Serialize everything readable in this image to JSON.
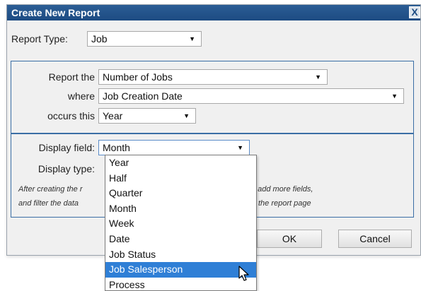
{
  "dialog": {
    "title": "Create New Report",
    "close_label": "X"
  },
  "report_type": {
    "label": "Report Type:",
    "value": "Job"
  },
  "criteria": {
    "report_the_label": "Report the",
    "report_the_value": "Number of Jobs",
    "where_label": "where",
    "where_value": "Job Creation Date",
    "occurs_label": "occurs this",
    "occurs_value": "Year"
  },
  "display": {
    "field_label": "Display field:",
    "field_value": "Month",
    "type_label": "Display type:"
  },
  "note": {
    "line1_start": "After creating the r",
    "line1_end": ", add more fields,",
    "line2_start": "and filter the data",
    "line2_end": "the report page"
  },
  "buttons": {
    "ok": "OK",
    "cancel": "Cancel"
  },
  "dropdown": {
    "options": [
      "Year",
      "Half",
      "Quarter",
      "Month",
      "Week",
      "Date",
      "Job Status",
      "Job Salesperson",
      "Process"
    ],
    "highlighted": "Job Salesperson"
  },
  "icons": {
    "caret": "caret-down-icon",
    "close": "close-icon",
    "cursor": "mouse-pointer-icon"
  }
}
